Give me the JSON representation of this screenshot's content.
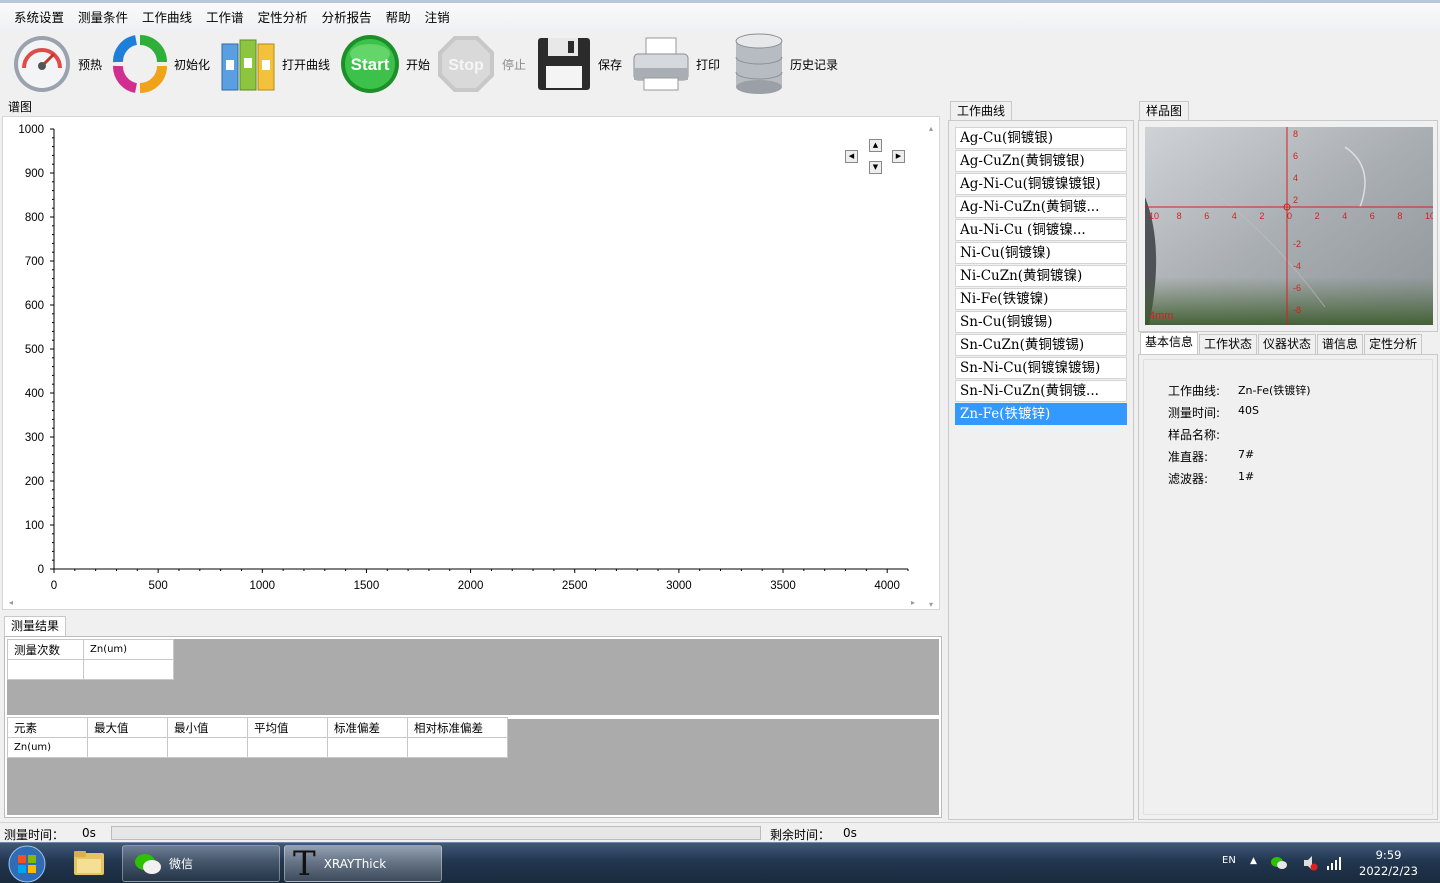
{
  "menu": [
    "系统设置",
    "测量条件",
    "工作曲线",
    "工作谱",
    "定性分析",
    "分析报告",
    "帮助",
    "注销"
  ],
  "toolbar": {
    "preheat": "预热",
    "init": "初始化",
    "open_curve": "打开曲线",
    "start_icon_text": "Start",
    "start": "开始",
    "stop_icon_text": "Stop",
    "stop": "停止",
    "save": "保存",
    "print": "打印",
    "history": "历史记录"
  },
  "spectrum": {
    "label": "谱图"
  },
  "chart_data": {
    "type": "line",
    "x": [],
    "y": [],
    "xlim": [
      0,
      4100
    ],
    "ylim": [
      0,
      1000
    ],
    "xticks": [
      0,
      500,
      1000,
      1500,
      2000,
      2500,
      3000,
      3500,
      4000
    ],
    "yticks": [
      0,
      100,
      200,
      300,
      400,
      500,
      600,
      700,
      800,
      900,
      1000
    ],
    "grid": false
  },
  "results": {
    "label": "测量结果",
    "table1_headers": [
      "测量次数",
      "Zn(um)"
    ],
    "table2_headers": [
      "元素",
      "最大值",
      "最小值",
      "平均值",
      "标准偏差",
      "相对标准偏差"
    ],
    "table2_row_label": "Zn(um)"
  },
  "curves": {
    "label": "工作曲线",
    "items": [
      "Ag-Cu(铜镀银)",
      "Ag-CuZn(黄铜镀银)",
      "Ag-Ni-Cu(铜镀镍镀银)",
      "Ag-Ni-CuZn(黄铜镀...",
      "Au-Ni-Cu (铜镀镍...",
      "Ni-Cu(铜镀镍)",
      "Ni-CuZn(黄铜镀镍)",
      "Ni-Fe(铁镀镍)",
      "Sn-Cu(铜镀锡)",
      "Sn-CuZn(黄铜镀锡)",
      "Sn-Ni-Cu(铜镀镍镀锡)",
      "Sn-Ni-CuZn(黄铜镀...",
      "Zn-Fe(铁镀锌)"
    ],
    "selected_index": 12
  },
  "sample": {
    "label": "样品图",
    "scale_text": "4mm",
    "h_ticks": [
      "10",
      "8",
      "6",
      "4",
      "2",
      "0",
      "2",
      "4",
      "6",
      "8",
      "10"
    ],
    "v_ticks": [
      "8",
      "6",
      "4",
      "2",
      "0",
      "-2",
      "-4",
      "-6",
      "-8"
    ]
  },
  "info": {
    "tabs": [
      "基本信息",
      "工作状态",
      "仪器状态",
      "谱信息",
      "定性分析"
    ],
    "active_tab": 0,
    "rows": [
      {
        "key": "工作曲线:",
        "value": "Zn-Fe(铁镀锌)"
      },
      {
        "key": "测量时间:",
        "value": "40S"
      },
      {
        "key": "样品名称:",
        "value": ""
      },
      {
        "key": "准直器:",
        "value": "7#"
      },
      {
        "key": "滤波器:",
        "value": "1#"
      }
    ]
  },
  "status": {
    "measure_time_label": "测量时间：",
    "measure_time": "0s",
    "remaining_label": "剩余时间：",
    "remaining": "0s",
    "progress": 0
  },
  "taskbar": {
    "wechat": "微信",
    "app": "XRAYThick",
    "app_icon_text": "T",
    "lang": "EN",
    "time": "9:59",
    "date": "2022/2/23"
  },
  "colors": {
    "selected": "#3399ff",
    "taskbar": "#22364f"
  }
}
